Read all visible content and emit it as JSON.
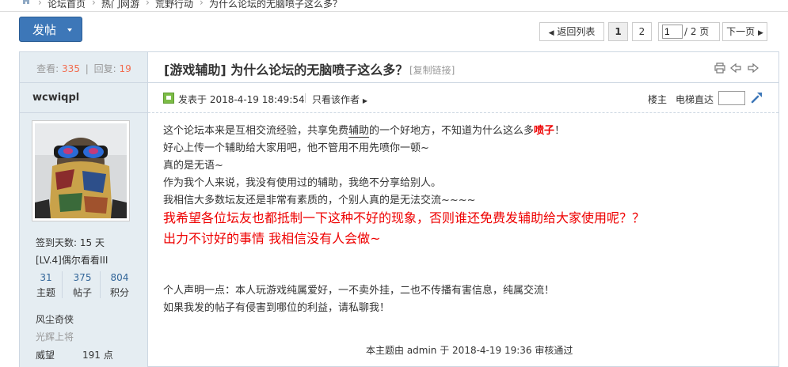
{
  "breadcrumb": {
    "items": [
      "论坛首页",
      "热门网游",
      "荒野行动",
      "为什么论坛的无脑喷子这么多？"
    ],
    "separator": "›"
  },
  "toolbar": {
    "post_label": "发帖"
  },
  "pagination": {
    "back_label": "返回列表",
    "pages": [
      "1",
      "2"
    ],
    "current_page": "1",
    "page_input": "1",
    "total_label": "/ 2 页",
    "next_label": "下一页"
  },
  "sidebar": {
    "stats": {
      "views_label": "查看:",
      "views": "335",
      "sep": "|",
      "replies_label": "回复:",
      "replies": "19"
    },
    "author": "wcwiqpl",
    "checkin": "签到天数: 15 天",
    "level": "[LV.4]偶尔看看III",
    "counts": [
      {
        "num": "31",
        "label": "主题"
      },
      {
        "num": "375",
        "label": "帖子"
      },
      {
        "num": "804",
        "label": "积分"
      }
    ],
    "rank": "风尘奇侠",
    "rank_sub": "光辉上将",
    "prestige_label": "威望",
    "prestige_value": "191 点"
  },
  "post": {
    "category": "[游戏辅助]",
    "title": "为什么论坛的无脑喷子这么多？",
    "copy_link": "[复制链接]",
    "posted_at": "发表于 2018-4-19 18:49:54",
    "only_author": "只看该作者",
    "floor": "楼主",
    "elevator": "电梯直达",
    "lines": {
      "l1a": "这个论坛本来是互相交流经验，共享免费",
      "l1b": "辅助",
      "l1c": "的一个好地方，不知道为什么这么多",
      "l1d": "喷子",
      "l1e": "！",
      "l2": "好心上传一个辅助给大家用吧，他不管用不用先喷你一顿~",
      "l3": "真的是无语~",
      "l4": "作为我个人来说，我没有使用过的辅助，我绝不分享给别人。",
      "l5": "我相信大多数坛友还是非常有素质的，个别人真的是无法交流~~~~",
      "l6": "我希望各位坛友也都抵制一下这种不好的现象，否则谁还免费发辅助给大家使用呢？？",
      "l7": "出力不讨好的事情 我相信没有人会做~",
      "l8": "个人声明一点：本人玩游戏纯属爱好，一不卖外挂，二也不传播有害信息，纯属交流！",
      "l9": "如果我发的帖子有侵害到哪位的利益，请私聊我！"
    },
    "audit": "本主题由 admin 于 2018-4-19 19:36 审核通过"
  }
}
